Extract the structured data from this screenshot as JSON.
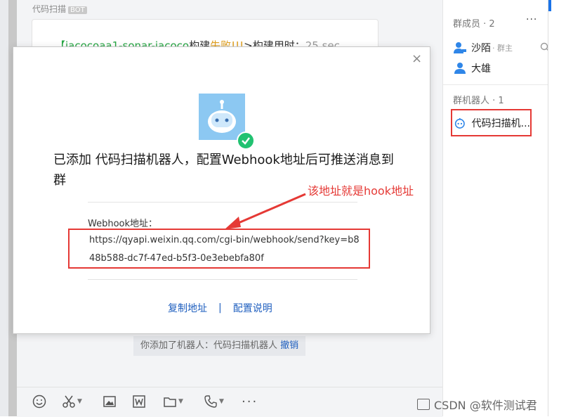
{
  "chat": {
    "top_label": "代码扫描",
    "top_tag": "BOT",
    "card": {
      "part1": "【jacocoaa1-sonar-jacoco",
      "part2": "构建",
      "part3": "失败!!!",
      "part4": ">构建用时：",
      "part5": "25 sec"
    },
    "system_notice": "你添加了机器人：代码扫描机器人",
    "undo": "撤销"
  },
  "right_panel": {
    "members_title": "群成员 · 2",
    "members": [
      {
        "name": "沙陌",
        "role": "· 群主"
      },
      {
        "name": "大雄",
        "role": ""
      }
    ],
    "robots_title": "群机器人 · 1",
    "robot_name": "代码扫描机..."
  },
  "modal": {
    "title": "已添加 代码扫描机器人，配置Webhook地址后可推送消息到群",
    "webhook_label": "Webhook地址：",
    "webhook_url": "https://qyapi.weixin.qq.com/cgi-bin/webhook/send?key=b848b588-dc7f-47ed-b5f3-0e3ebebfa80f",
    "copy_link": "复制地址",
    "separator": "|",
    "config_link": "配置说明",
    "close": "×"
  },
  "annotation": "该地址就是hook地址",
  "watermark": "CSDN @软件测试君",
  "colors": {
    "accent_red": "#e53935",
    "link_blue": "#1f5fbf",
    "check_green": "#21c271"
  }
}
